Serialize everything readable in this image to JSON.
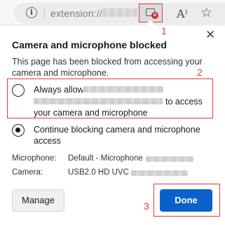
{
  "toolbar": {
    "url_text": "extension://",
    "icons": {
      "site_info": "info-icon",
      "camera_blocked": "camera-blocked-icon",
      "read_aloud": "read-aloud-icon",
      "favorites": "add-favorite-icon"
    },
    "info_glyph": "i",
    "read_aloud_glyph": "A⁾",
    "favorite_glyph": "☆"
  },
  "markers": {
    "one": "1",
    "two": "2",
    "three": "3"
  },
  "popup": {
    "title": "Camera and microphone blocked",
    "close_glyph": "✕",
    "description": "This page has been blocked from accessing your camera and microphone.",
    "options": {
      "allow_prefix": "Always allow",
      "allow_suffix": "to access",
      "allow_line3": "your camera and microphone",
      "continue_label": "Continue blocking camera and microphone access",
      "selected": "continue"
    },
    "devices": {
      "microphone_label": "Microphone:",
      "microphone_value": "Default - Microphone",
      "camera_label": "Camera:",
      "camera_value": "USB2.0 HD UVC"
    },
    "buttons": {
      "manage": "Manage",
      "done": "Done"
    }
  },
  "colors": {
    "accent": "#0a62c9",
    "highlight": "#e53935"
  }
}
